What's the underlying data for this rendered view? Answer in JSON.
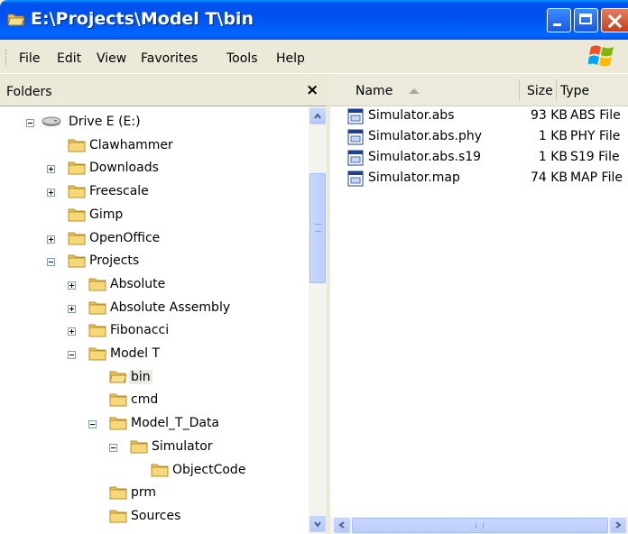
{
  "window": {
    "title": "E:\\Projects\\Model T\\bin",
    "title_icon": "open-folder-icon",
    "controls": [
      "minimize",
      "maximize",
      "close"
    ],
    "titlebar_color": "#0054e3"
  },
  "menu": {
    "file": "File",
    "edit": "Edit",
    "view": "View",
    "favorites": "Favorites",
    "tools": "Tools",
    "help": "Help"
  },
  "folders_pane": {
    "title": "Folders",
    "close_glyph": "×",
    "tree": [
      {
        "label": "Drive E (E:)",
        "icon": "drive-icon",
        "expander": "minus",
        "level": 0
      },
      {
        "label": "Clawhammer",
        "icon": "folder-icon",
        "expander": "none",
        "level": 1
      },
      {
        "label": "Downloads",
        "icon": "folder-icon",
        "expander": "plus",
        "level": 1
      },
      {
        "label": "Freescale",
        "icon": "folder-icon",
        "expander": "plus",
        "level": 1
      },
      {
        "label": "Gimp",
        "icon": "folder-icon",
        "expander": "none",
        "level": 1
      },
      {
        "label": "OpenOffice",
        "icon": "folder-icon",
        "expander": "plus",
        "level": 1
      },
      {
        "label": "Projects",
        "icon": "folder-icon",
        "expander": "minus",
        "level": 1
      },
      {
        "label": "Absolute",
        "icon": "folder-icon",
        "expander": "plus",
        "level": 2
      },
      {
        "label": "Absolute Assembly",
        "icon": "folder-icon",
        "expander": "plus",
        "level": 2
      },
      {
        "label": "Fibonacci",
        "icon": "folder-icon",
        "expander": "plus",
        "level": 2
      },
      {
        "label": "Model T",
        "icon": "folder-icon",
        "expander": "minus",
        "level": 2
      },
      {
        "label": "bin",
        "icon": "open-folder-icon",
        "expander": "none",
        "level": 3,
        "selected": true
      },
      {
        "label": "cmd",
        "icon": "folder-icon",
        "expander": "none",
        "level": 3
      },
      {
        "label": "Model_T_Data",
        "icon": "folder-icon",
        "expander": "minus",
        "level": 3
      },
      {
        "label": "Simulator",
        "icon": "folder-icon",
        "expander": "minus",
        "level": 4
      },
      {
        "label": "ObjectCode",
        "icon": "folder-icon",
        "expander": "none",
        "level": 5
      },
      {
        "label": "prm",
        "icon": "folder-icon",
        "expander": "none",
        "level": 3
      },
      {
        "label": "Sources",
        "icon": "folder-icon",
        "expander": "none",
        "level": 3
      }
    ]
  },
  "files_pane": {
    "columns": {
      "name": "Name",
      "size": "Size",
      "type": "Type"
    },
    "sort": "name-ascending",
    "rows": [
      {
        "name": "Simulator.abs",
        "size": "93 KB",
        "type": "ABS File"
      },
      {
        "name": "Simulator.abs.phy",
        "size": "1 KB",
        "type": "PHY File"
      },
      {
        "name": "Simulator.abs.s19",
        "size": "1 KB",
        "type": "S19 File"
      },
      {
        "name": "Simulator.map",
        "size": "74 KB",
        "type": "MAP File"
      }
    ]
  }
}
